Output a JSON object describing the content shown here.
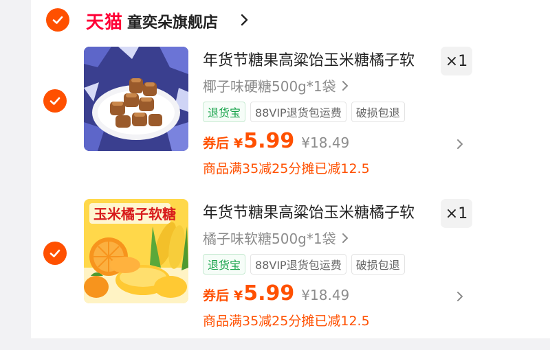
{
  "colors": {
    "accent": "#ff5000",
    "tmall_red": "#ff0036",
    "tag_green": "#17a34a",
    "muted": "#8c8c8c"
  },
  "shop": {
    "brand": "天猫",
    "name": "童奕朵旗舰店",
    "selected": true
  },
  "items": [
    {
      "selected": true,
      "image_icon": "caramel-candy-image",
      "title": "年货节糖果高粱饴玉米糖橘子软",
      "quantity": "×1",
      "sku": "椰子味硬糖500g*1袋",
      "tags": [
        "退货宝",
        "88VIP退货包运费",
        "破损包退"
      ],
      "price_label": "券后",
      "currency": "¥",
      "price": "5.99",
      "original_price": "¥18.49",
      "promo": "商品满35减25分摊已减12.5"
    },
    {
      "selected": true,
      "image_icon": "corn-orange-candy-image",
      "image_text": "玉米橘子软糖",
      "title": "年货节糖果高粱饴玉米糖橘子软",
      "quantity": "×1",
      "sku": "橘子味软糖500g*1袋",
      "tags": [
        "退货宝",
        "88VIP退货包运费",
        "破损包退"
      ],
      "price_label": "券后",
      "currency": "¥",
      "price": "5.99",
      "original_price": "¥18.49",
      "promo": "商品满35减25分摊已减12.5"
    }
  ]
}
